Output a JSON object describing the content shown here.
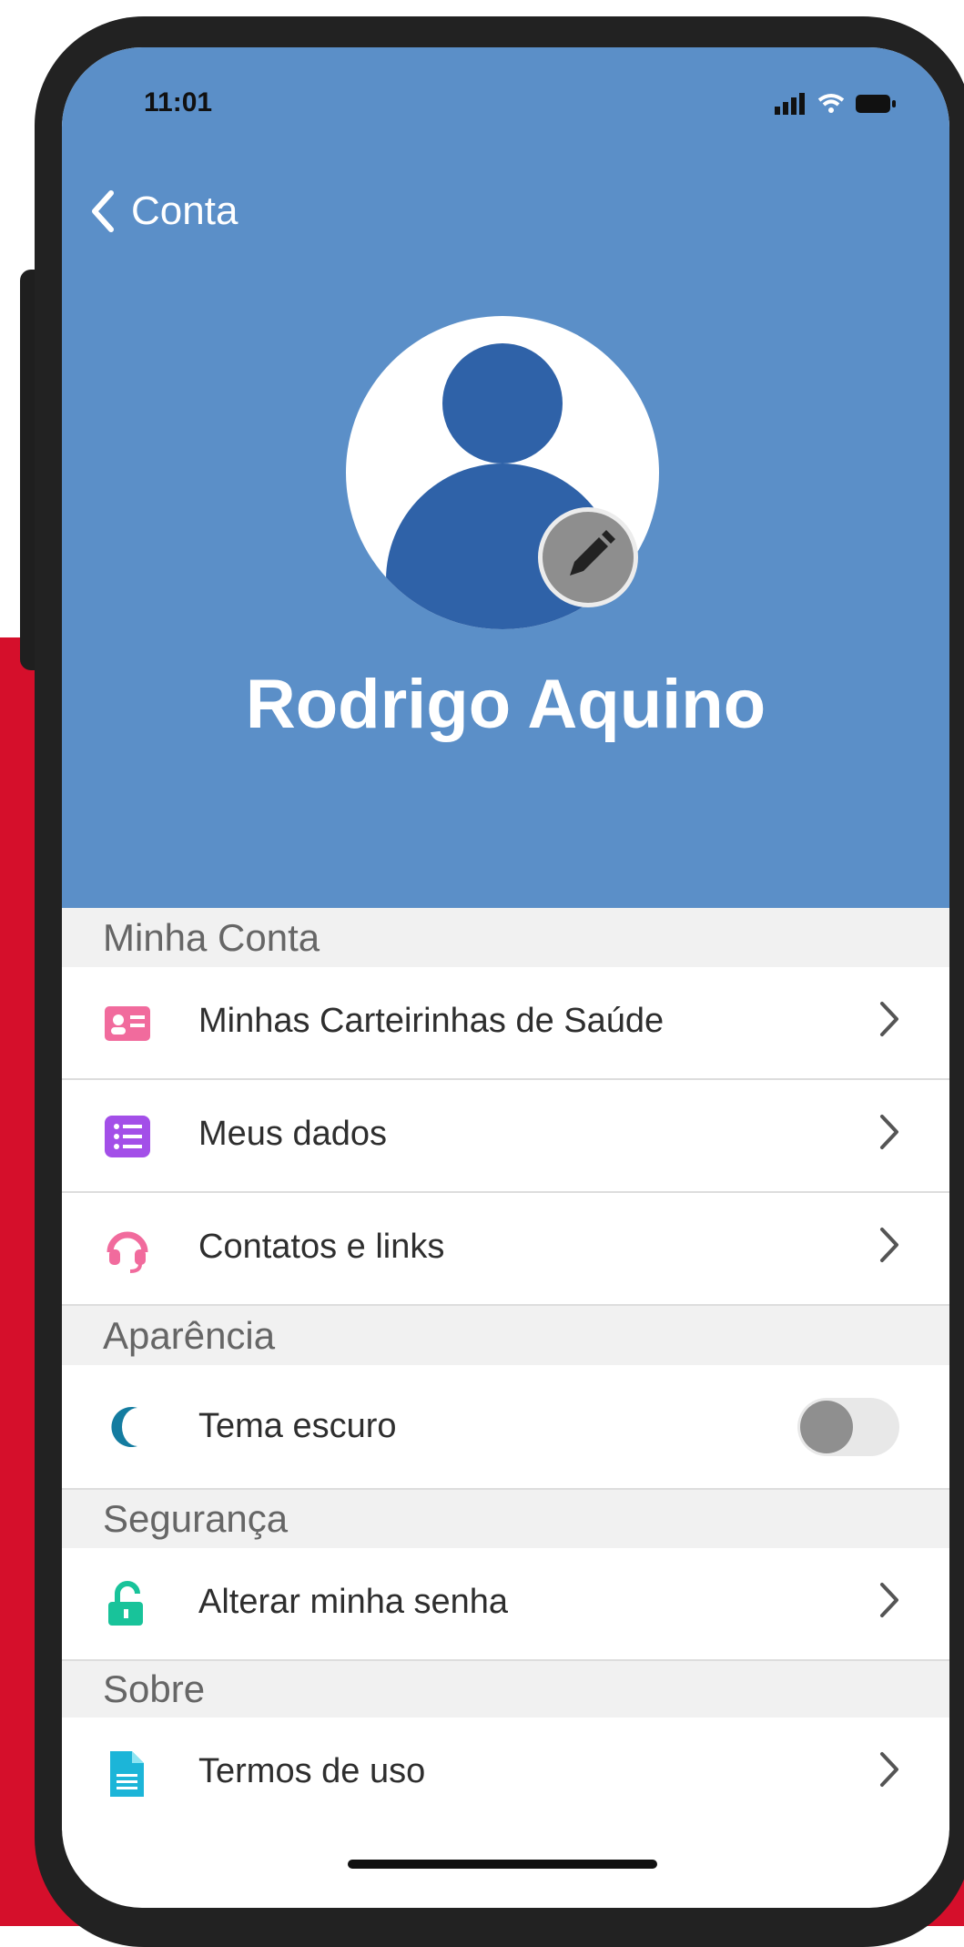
{
  "status": {
    "time": "11:01"
  },
  "nav": {
    "back_label": "Conta"
  },
  "profile": {
    "name": "Rodrigo Aquino"
  },
  "sections": {
    "account_title": "Minha Conta",
    "appearance_title": "Aparência",
    "security_title": "Segurança",
    "about_title": "Sobre"
  },
  "items": {
    "health_cards": "Minhas Carteirinhas de Saúde",
    "my_data": "Meus dados",
    "contacts_links": "Contatos e links",
    "dark_theme": "Tema escuro",
    "change_password": "Alterar minha senha",
    "terms": "Termos de uso"
  },
  "toggle": {
    "dark_theme_on": false
  },
  "colors": {
    "header_blue": "#5b8fc8",
    "avatar_blue": "#2f62a8",
    "brand_red": "#d50f2b",
    "pink_icon": "#f16b9d",
    "purple_icon": "#a34fe8",
    "teal_icon": "#147ca0",
    "green_icon": "#18c39a",
    "cyan_icon": "#1cb5d8"
  },
  "icons": [
    "back-chevron-icon",
    "signal-icon",
    "wifi-icon",
    "battery-icon",
    "pencil-icon",
    "id-card-icon",
    "list-icon",
    "headset-icon",
    "moon-icon",
    "unlock-icon",
    "document-icon",
    "chevron-right-icon"
  ]
}
